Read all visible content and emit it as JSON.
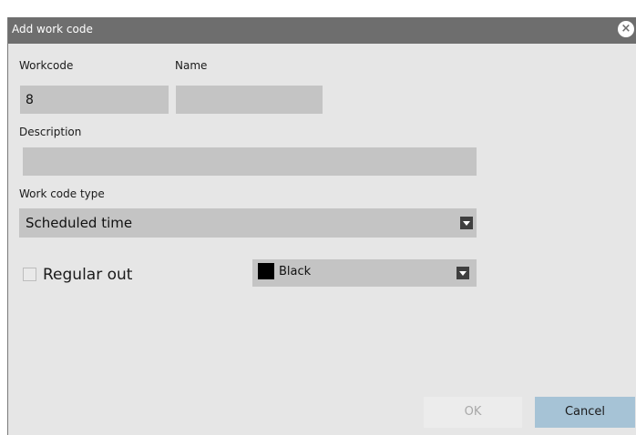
{
  "dialog": {
    "title": "Add work code",
    "close_icon": "close-circle-icon"
  },
  "form": {
    "workcode_label": "Workcode",
    "workcode_value": "8",
    "name_label": "Name",
    "name_value": "",
    "description_label": "Description",
    "description_value": "",
    "type_label": "Work code type",
    "type_value": "Scheduled time",
    "regular_out_label": "Regular out",
    "regular_out_checked": false,
    "color_value": "Black",
    "color_swatch": "#000000"
  },
  "buttons": {
    "ok_label": "OK",
    "cancel_label": "Cancel"
  },
  "colors": {
    "titlebar": "#6e6e6e",
    "background": "#e6e6e6",
    "field": "#c4c4c4",
    "cancel_button": "#a6c3d6"
  }
}
